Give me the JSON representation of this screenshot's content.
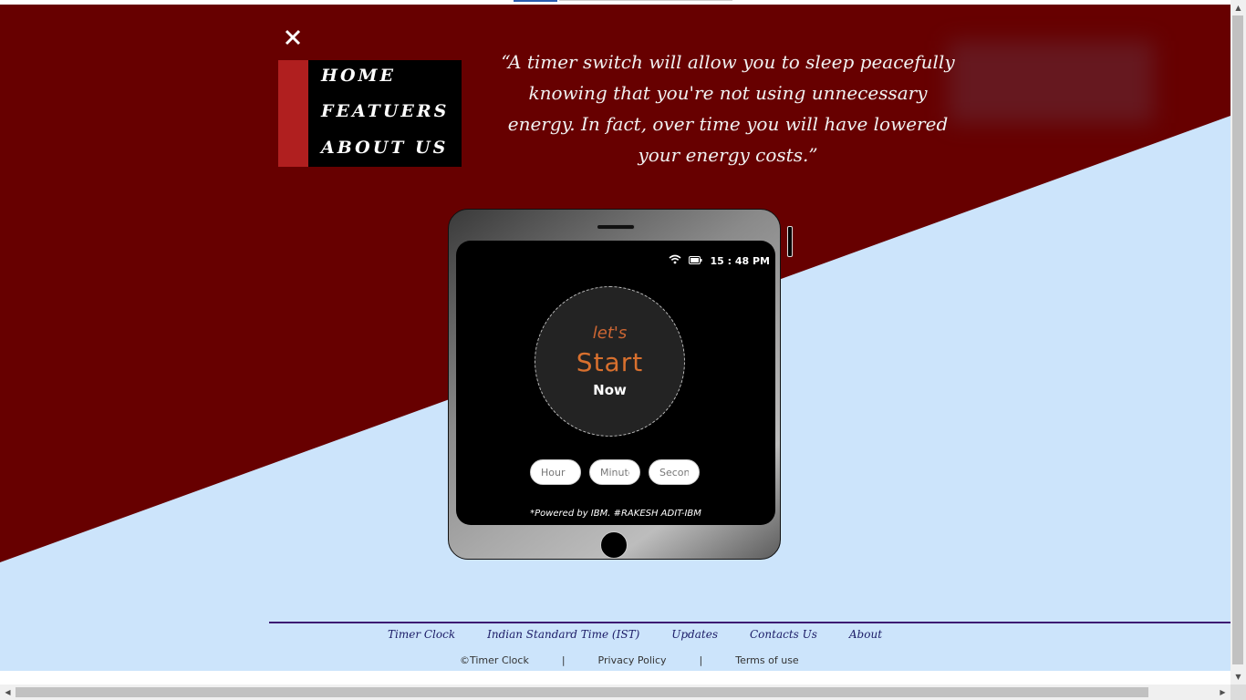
{
  "nav": {
    "close_icon": "close-icon",
    "items": [
      {
        "label": "HOME"
      },
      {
        "label": "FEATUERS"
      },
      {
        "label": "ABOUT US"
      }
    ]
  },
  "quote": {
    "text": "“A timer switch will allow you to sleep peacefully knowing that you're not using unnecessary energy. In fact, over time you will have lowered your energy costs.”"
  },
  "phone": {
    "status": {
      "time": "15 : 48 PM",
      "wifi_icon": "wifi-icon",
      "battery_icon": "battery-icon"
    },
    "dial": {
      "lets": "let's",
      "start": "Start",
      "now": "Now"
    },
    "inputs": {
      "hour_placeholder": "Hour",
      "minute_placeholder": "Minute",
      "second_placeholder": "Second"
    },
    "powered": "*Powered by IBM. #RAKESH ADIT-IBM"
  },
  "footer": {
    "links": [
      "Timer Clock",
      "Indian Standard Time (IST)",
      "Updates",
      "Contacts Us",
      "About"
    ],
    "copyright": "©Timer Clock",
    "separator": "|",
    "privacy": "Privacy Policy",
    "terms": "Terms of use"
  },
  "colors": {
    "header_red": "#670000",
    "accent_red": "#b01f1f",
    "light_blue": "#cce4fb",
    "dial_orange": "#d8702e"
  }
}
